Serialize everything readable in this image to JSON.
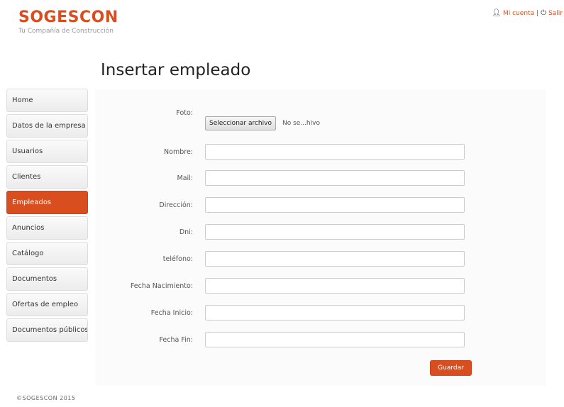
{
  "brand": {
    "name": "SOGESCON",
    "tagline": "Tu Compañía de Construcción"
  },
  "topnav": {
    "account": "Mi cuenta",
    "separator": "|",
    "logout": "Salir"
  },
  "page_title": "Insertar empleado",
  "sidebar": {
    "items": [
      {
        "label": "Home"
      },
      {
        "label": "Datos de la empresa"
      },
      {
        "label": "Usuarios"
      },
      {
        "label": "Clientes"
      },
      {
        "label": "Empleados"
      },
      {
        "label": "Anuncios"
      },
      {
        "label": "Catálogo"
      },
      {
        "label": "Documentos"
      },
      {
        "label": "Ofertas de empleo"
      },
      {
        "label": "Documentos públicos"
      }
    ],
    "active_index": 4
  },
  "form": {
    "foto_label": "Foto:",
    "file_button": "Seleccionar archivo",
    "file_status": "No se...hivo",
    "fields": [
      {
        "label": "Nombre:",
        "value": ""
      },
      {
        "label": "Mail:",
        "value": ""
      },
      {
        "label": "Dirección:",
        "value": ""
      },
      {
        "label": "Dni:",
        "value": ""
      },
      {
        "label": "teléfono:",
        "value": ""
      },
      {
        "label": "Fecha Nacimiento:",
        "value": ""
      },
      {
        "label": "Fecha Inicio:",
        "value": ""
      },
      {
        "label": "Fecha Fin:",
        "value": ""
      }
    ],
    "submit": "Guardar"
  },
  "footer": "©SOGESCON 2015",
  "colors": {
    "accent": "#d94e1f",
    "panel": "#fbfbfb",
    "sidebar_bg": "#f2f2f2"
  },
  "icons": {
    "account": "user-icon",
    "logout": "power-icon"
  }
}
